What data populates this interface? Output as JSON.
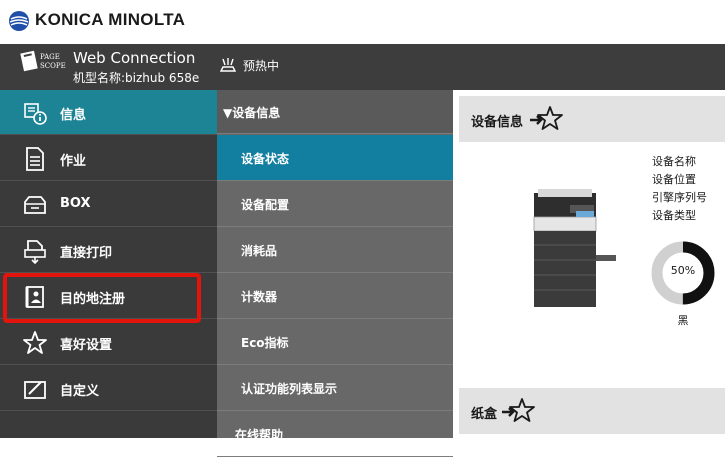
{
  "brand": {
    "name": "KONICA MINOLTA"
  },
  "header": {
    "app_title": "Web Connection",
    "logo_text_top": "PAGE",
    "logo_text_bottom": "SCOPE",
    "model": "机型名称:bizhub 658e",
    "status": "预热中",
    "status_icon": "warmup-icon"
  },
  "nav": {
    "items": [
      {
        "label": "信息",
        "icon": "info-icon",
        "active": true
      },
      {
        "label": "作业",
        "icon": "document-icon"
      },
      {
        "label": "BOX",
        "icon": "box-icon"
      },
      {
        "label": "直接打印",
        "icon": "direct-print-icon"
      },
      {
        "label": "目的地注册",
        "icon": "address-book-icon"
      },
      {
        "label": "喜好设置",
        "icon": "star-icon"
      },
      {
        "label": "自定义",
        "icon": "customize-icon"
      }
    ]
  },
  "subnav": {
    "header": "▼设备信息",
    "items": [
      {
        "label": "设备状态",
        "active": true
      },
      {
        "label": "设备配置"
      },
      {
        "label": "消耗品"
      },
      {
        "label": "计数器"
      },
      {
        "label": "Eco指标"
      },
      {
        "label": "认证功能列表显示"
      },
      {
        "label": "在线帮助"
      }
    ]
  },
  "content": {
    "device_panel_title": "设备信息",
    "info_labels": [
      "设备名称",
      "设备位置",
      "引擎序列号",
      "设备类型"
    ],
    "toner": {
      "value_text": "50%",
      "level": 0.5,
      "label": "黑"
    },
    "tray_panel_title": "纸盒"
  },
  "colors": {
    "header_bg": "#3d3d3d",
    "nav_bg": "#3a3a3a",
    "nav_active": "#1d8496",
    "subnav_bg": "#686868",
    "subnav_active": "#137fa0",
    "highlight": "#e3140c"
  }
}
